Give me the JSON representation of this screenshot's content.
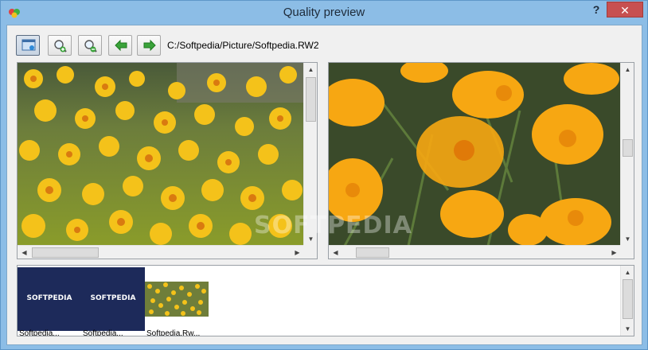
{
  "window": {
    "title": "Quality preview",
    "help_label": "?",
    "close_label": "✕"
  },
  "toolbar": {
    "buttons": [
      {
        "name": "view-mode-button",
        "icon": "view-mode-icon"
      },
      {
        "name": "zoom-in-button",
        "icon": "zoom-in-icon"
      },
      {
        "name": "zoom-out-button",
        "icon": "zoom-out-icon"
      },
      {
        "name": "previous-button",
        "icon": "arrow-left-icon"
      },
      {
        "name": "next-button",
        "icon": "arrow-right-icon"
      }
    ],
    "file_path": "C:/Softpedia/Picture/Softpedia.RW2"
  },
  "thumbnails": [
    {
      "brand": "SOFTPEDIA",
      "label": "Softpedia..."
    },
    {
      "brand": "SOFTPEDIA",
      "label": "Softpedia..."
    },
    {
      "brand": "",
      "label": "Softpedia.Rw..."
    }
  ],
  "watermark": "SOFTPEDIA",
  "colors": {
    "titlebar": "#8cbde6",
    "close_button": "#c75050",
    "thumb_background": "#1d2a5a",
    "arrow_green": "#3aa33a"
  }
}
